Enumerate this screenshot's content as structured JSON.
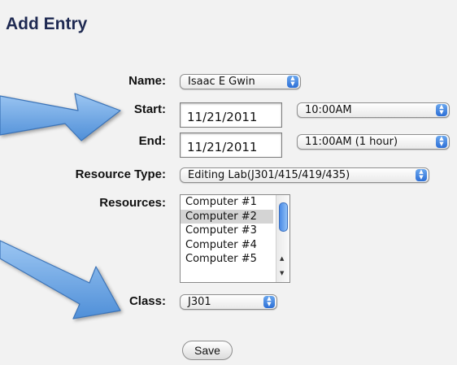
{
  "form": {
    "title": "Add Entry",
    "name_label": "Name:",
    "name_value": "Isaac E Gwin",
    "start_label": "Start:",
    "start_date": "11/21/2011",
    "start_time": "10:00AM",
    "end_label": "End:",
    "end_date": "11/21/2011",
    "end_time": "11:00AM  (1 hour)",
    "resource_type_label": "Resource Type:",
    "resource_type_value": "Editing Lab(J301/415/419/435)",
    "resources_label": "Resources:",
    "resources": [
      "Computer #1",
      "Computer #2",
      "Computer #3",
      "Computer #4",
      "Computer #5"
    ],
    "resources_selected": "Computer #2",
    "class_label": "Class:",
    "class_value": "J301",
    "save_label": "Save"
  },
  "colors": {
    "title": "#1f2a52",
    "callout_arrow": "#6fa8e6",
    "background": "#f2f2f2"
  }
}
